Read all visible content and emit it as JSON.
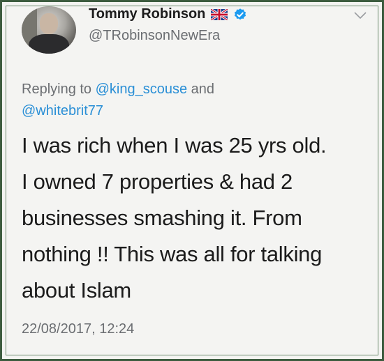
{
  "tweet": {
    "author_name": "Tommy Robinson",
    "author_handle": "@TRobinsonNewEra",
    "reply": {
      "prefix": "Replying to ",
      "mention_1": "@king_scouse",
      "connector": " and",
      "mention_2": "@whitebrit77"
    },
    "text_lines": [
      "I was rich when I was 25 yrs old.",
      "I owned 7 properties & had 2",
      "businesses smashing it. From",
      "nothing !! This was all for talking",
      "about Islam"
    ],
    "timestamp": "22/08/2017, 12:24"
  },
  "icons": {
    "flag": "uk-flag-icon",
    "verified": "verified-badge-icon",
    "menu": "chevron-down-icon",
    "avatar": "profile-photo"
  },
  "colors": {
    "name": "#1c1c1c",
    "secondary": "#6b6e72",
    "mention": "#2a8fd6",
    "verified": "#1d9bf0",
    "frame": "#3d5c3f"
  }
}
